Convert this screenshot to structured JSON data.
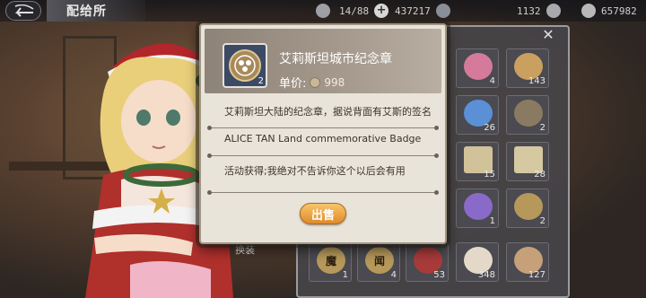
{
  "header": {
    "title": "配给所",
    "resources": [
      {
        "icon": "fuel-icon",
        "value": "14/88"
      },
      {
        "icon": "ammo-icon",
        "value": "437217"
      },
      {
        "icon": "gem-icon",
        "value": "1132"
      },
      {
        "icon": "coin-icon",
        "value": "657982"
      }
    ]
  },
  "inventory": {
    "equip_label": "换装",
    "slots": [
      {
        "count": "4",
        "icon": "pink-item-icon"
      },
      {
        "count": "143",
        "icon": "ship-icon"
      },
      {
        "count": "26",
        "icon": "perfume-bottle-icon"
      },
      {
        "count": "2",
        "icon": "medal-icon"
      },
      {
        "count": "15",
        "icon": "scroll-icon"
      },
      {
        "count": "28",
        "icon": "scroll-icon"
      },
      {
        "count": "1",
        "icon": "bouquet-icon"
      },
      {
        "count": "2",
        "icon": "coin-icon"
      },
      {
        "count": "1",
        "icon": "coin-icon",
        "glyph": "魔"
      },
      {
        "count": "4",
        "icon": "coin-icon",
        "glyph": "闻"
      },
      {
        "count": "53",
        "icon": "cherry-icon"
      },
      {
        "count": "348",
        "icon": "cake-icon"
      },
      {
        "count": "127",
        "icon": "pudding-icon"
      }
    ]
  },
  "tooltip": {
    "item_name": "艾莉斯坦城市纪念章",
    "quantity": "2",
    "price_label": "单价:",
    "price": "998",
    "description": "艾莉斯坦大陆的纪念章，据说背面有艾斯的签名",
    "description_en": "ALICE TAN Land commemorative Badge",
    "source": "活动获得;我绝对不告诉你这个以后会有用",
    "sell_label": "出售"
  },
  "colors": {
    "accent": "#e08a2a",
    "modal_bg": "#e9e4da",
    "header_bg": "#a69a8e"
  }
}
